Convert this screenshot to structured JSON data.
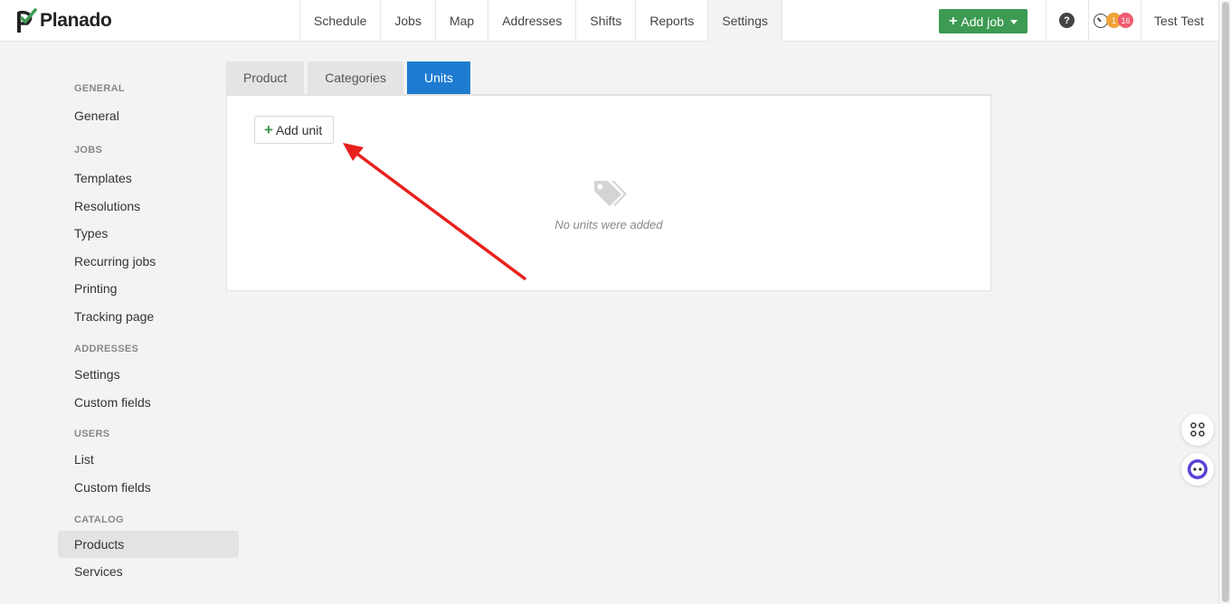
{
  "app": {
    "logo_text": "Planado"
  },
  "nav": {
    "items": [
      {
        "label": "Schedule"
      },
      {
        "label": "Jobs"
      },
      {
        "label": "Map"
      },
      {
        "label": "Addresses"
      },
      {
        "label": "Shifts"
      },
      {
        "label": "Reports"
      },
      {
        "label": "Settings",
        "active": true
      }
    ]
  },
  "header": {
    "add_job_label": "Add job",
    "help_label": "?",
    "notif_count_orange": "1",
    "notif_count_red": "16",
    "user_name": "Test Test"
  },
  "sidebar": {
    "general": {
      "title": "GENERAL",
      "items": [
        "General"
      ]
    },
    "jobs": {
      "title": "JOBS",
      "items": [
        "Templates",
        "Resolutions",
        "Types",
        "Recurring jobs",
        "Printing",
        "Tracking page"
      ]
    },
    "addresses": {
      "title": "ADDRESSES",
      "items": [
        "Settings",
        "Custom fields"
      ]
    },
    "users": {
      "title": "USERS",
      "items": [
        "List",
        "Custom fields"
      ]
    },
    "catalog": {
      "title": "CATALOG",
      "items": [
        "Products",
        "Services"
      ],
      "active": "Products"
    }
  },
  "tabs": [
    {
      "label": "Product"
    },
    {
      "label": "Categories"
    },
    {
      "label": "Units",
      "active": true
    }
  ],
  "panel": {
    "add_unit_label": "Add unit",
    "empty_text": "No units were added",
    "empty_icon": "tags-icon"
  },
  "colors": {
    "accent_green": "#3d9a53",
    "tab_active_blue": "#1f7bd0",
    "annotation_red": "#e8201c",
    "badge_orange": "#f0a23b",
    "badge_red": "#ef5b6f"
  }
}
